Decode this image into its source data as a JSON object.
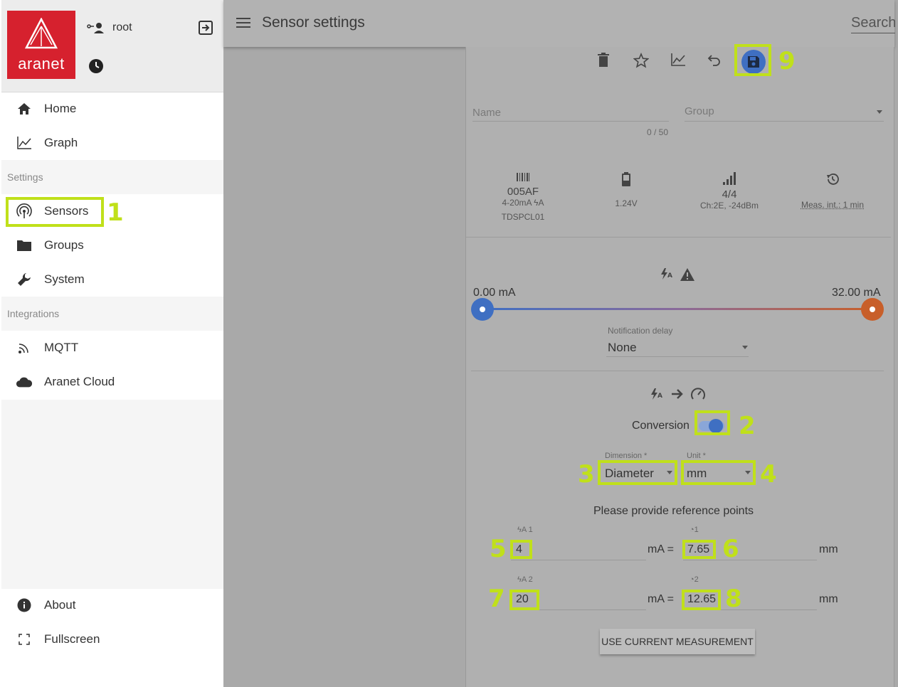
{
  "sidebar": {
    "logo_text": "aranet",
    "user": "root",
    "items": {
      "home": "Home",
      "graph": "Graph",
      "settings_section": "Settings",
      "sensors": "Sensors",
      "groups": "Groups",
      "system": "System",
      "integrations_section": "Integrations",
      "mqtt": "MQTT",
      "aranet_cloud": "Aranet Cloud",
      "about": "About",
      "fullscreen": "Fullscreen"
    }
  },
  "header": {
    "title": "Sensor settings",
    "search_placeholder": "Search"
  },
  "sensor": {
    "name_label": "Name",
    "name_counter": "0 / 50",
    "group_label": "Group",
    "id": "005AF",
    "type": "4-20mA",
    "model": "TDSPCL01",
    "voltage": "1.24V",
    "signal": "4/4",
    "channel": "Ch:2E, -24dBm",
    "interval": "Meas. int.: 1 min"
  },
  "range": {
    "min": "0.00 mA",
    "max": "32.00 mA",
    "notification_delay_label": "Notification delay",
    "notification_delay_value": "None"
  },
  "conversion": {
    "label": "Conversion",
    "enabled": true,
    "dimension_label": "Dimension *",
    "dimension_value": "Diameter",
    "unit_label": "Unit *",
    "unit_value": "mm",
    "reference_prompt": "Please provide reference points",
    "point1_ma_label": "1",
    "point1_ma": "4",
    "point1_value_label": "1",
    "point1_value": "7.65",
    "point2_ma_label": "2",
    "point2_ma": "20",
    "point2_value_label": "2",
    "point2_value": "12.65",
    "ma_eq": "mA =",
    "unit_suffix": "mm",
    "use_current_button": "USE CURRENT MEASUREMENT"
  },
  "annotations": [
    "1",
    "2",
    "3",
    "4",
    "5",
    "6",
    "7",
    "8",
    "9"
  ],
  "colors": {
    "brand": "#d6212e",
    "accent": "#3f6fc2",
    "highlight": "#c0e01a",
    "range_end": "#c85f2a"
  }
}
